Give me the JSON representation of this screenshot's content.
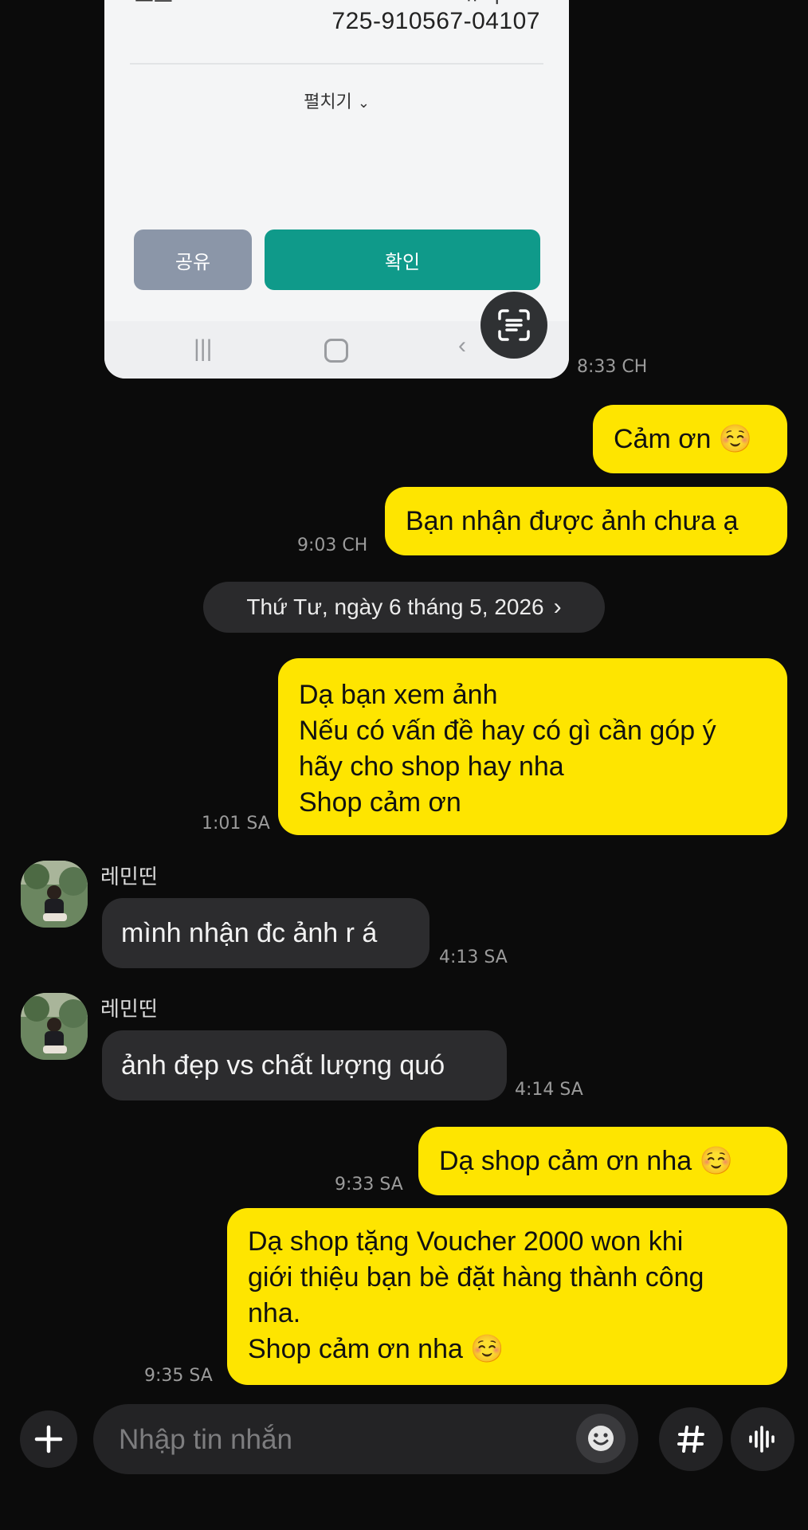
{
  "shared_screenshot": {
    "cut_text_left": "끄으ㄱ",
    "cut_text_right": "ㅠ니ㄴㅇ",
    "account_number": "725-910567-04107",
    "expand_label": "펼치기",
    "share_button": "공유",
    "confirm_button": "확인",
    "time": "8:33 CH"
  },
  "messages": [
    {
      "side": "me",
      "lines": [
        "Cảm ơn ☺️"
      ]
    },
    {
      "side": "me",
      "lines": [
        "Bạn nhận được ảnh chưa ạ"
      ],
      "time": "9:03 CH"
    }
  ],
  "date_divider": "Thứ Tư, ngày 6 tháng 5, 2026",
  "messages_after": [
    {
      "side": "me",
      "lines": [
        "Dạ bạn xem ảnh",
        "Nếu có vấn đề hay có gì cần góp ý",
        "hãy cho shop hay nha",
        "Shop cảm ơn"
      ],
      "time": "1:01 SA"
    },
    {
      "side": "other",
      "sender": "레민띤",
      "lines": [
        "mình nhận đc ảnh r á"
      ],
      "time": "4:13 SA"
    },
    {
      "side": "other",
      "sender": "레민띤",
      "lines": [
        "ảnh đẹp vs chất lượng quó"
      ],
      "time": "4:14 SA"
    },
    {
      "side": "me",
      "lines": [
        "Dạ shop cảm ơn nha ☺️"
      ],
      "time": "9:33 SA"
    },
    {
      "side": "me",
      "lines": [
        "Dạ shop tặng Voucher 2000 won khi",
        "giới thiệu bạn bè đặt hàng thành công",
        "nha.",
        "Shop cảm ơn nha ☺️"
      ],
      "time": "9:35 SA"
    }
  ],
  "composer": {
    "placeholder": "Nhập tin nhắn"
  },
  "icons": {
    "add": "plus-icon",
    "emoji": "emoji-icon",
    "hashtag": "hashtag-icon",
    "voice": "voice-icon",
    "scan": "text-scan-icon"
  },
  "colors": {
    "my_bubble": "#fee500",
    "other_bubble": "#2c2c2e",
    "background": "#0b0b0b",
    "confirm_button": "#0f9a8a"
  }
}
